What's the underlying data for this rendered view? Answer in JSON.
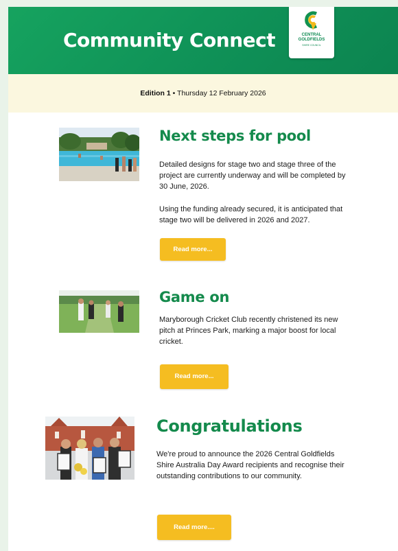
{
  "header": {
    "title": "Community Connect",
    "logo": {
      "line1": "CENTRAL",
      "line2": "GOLDFIELDS",
      "line3": "SHIRE COUNCIL"
    }
  },
  "edition": {
    "label": "Edition 1",
    "separator": " • ",
    "date": "Thursday 12 February 2026"
  },
  "articles": [
    {
      "title": "Next steps for pool",
      "paragraphs": [
        "Detailed designs for stage two and stage three of the project are currently underway and will be completed by 30 June, 2026.",
        "Using the funding already secured, it is anticipated that stage two will be delivered in 2026 and 2027."
      ],
      "button": "Read more..."
    },
    {
      "title": "Game on",
      "paragraphs": [
        "Maryborough Cricket Club recently christened its new pitch at Princes Park, marking a major boost for local cricket."
      ],
      "button": "Read more..."
    },
    {
      "title": "Congratulations",
      "paragraphs": [
        "We're proud to announce the 2026 Central Goldfields Shire Australia Day Award recipients and recognise their outstanding contributions to our community."
      ],
      "button": "Read more...."
    }
  ],
  "colors": {
    "header_green": "#11965a",
    "title_green": "#148a4c",
    "button_yellow": "#f5bd21",
    "edition_bg": "#fbf7df"
  }
}
